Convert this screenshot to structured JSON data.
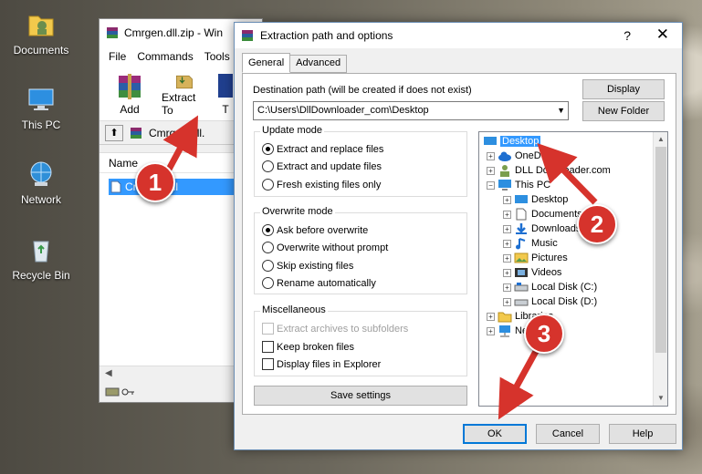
{
  "desktop": {
    "icons": [
      {
        "label": "Documents",
        "icon": "documents-icon"
      },
      {
        "label": "This PC",
        "icon": "this-pc-icon"
      },
      {
        "label": "Network",
        "icon": "network-icon"
      },
      {
        "label": "Recycle Bin",
        "icon": "recycle-bin-icon"
      }
    ]
  },
  "winrar": {
    "title": "Cmrgen.dll.zip - Win",
    "menu": [
      "File",
      "Commands",
      "Tools"
    ],
    "toolbar": {
      "add": "Add",
      "extract_to": "Extract To",
      "third": "T"
    },
    "path": "Cmrgen.dll.",
    "column_name": "Name",
    "file": "Cmrgen.dll"
  },
  "dialog": {
    "title": "Extraction path and options",
    "help": "?",
    "close": "✕",
    "tabs": [
      "General",
      "Advanced"
    ],
    "destination_label": "Destination path (will be created if does not exist)",
    "destination_value": "C:\\Users\\DllDownloader_com\\Desktop",
    "buttons": {
      "display": "Display",
      "new_folder": "New Folder",
      "save_settings": "Save settings",
      "ok": "OK",
      "cancel": "Cancel",
      "help": "Help"
    },
    "update_mode": {
      "title": "Update mode",
      "options": [
        "Extract and replace files",
        "Extract and update files",
        "Fresh existing files only"
      ],
      "selected": 0
    },
    "overwrite_mode": {
      "title": "Overwrite mode",
      "options": [
        "Ask before overwrite",
        "Overwrite without prompt",
        "Skip existing files",
        "Rename automatically"
      ],
      "selected": 0
    },
    "misc": {
      "title": "Miscellaneous",
      "options": [
        "Extract archives to subfolders",
        "Keep broken files",
        "Display files in Explorer"
      ]
    },
    "tree": {
      "desktop": "Desktop",
      "onedrive": "OneD",
      "dll_downloader": "DLL Downloader.com",
      "this_pc": "This PC",
      "pc_desktop": "Desktop",
      "documents": "Documents",
      "downloads": "Downloads",
      "music": "Music",
      "pictures": "Pictures",
      "videos": "Videos",
      "local_c": "Local Disk (C:)",
      "local_d": "Local Disk (D:)",
      "libraries": "Libraries",
      "network": "Ne"
    }
  },
  "annotations": {
    "step1": "1",
    "step2": "2",
    "step3": "3",
    "color": "#d6332c"
  }
}
